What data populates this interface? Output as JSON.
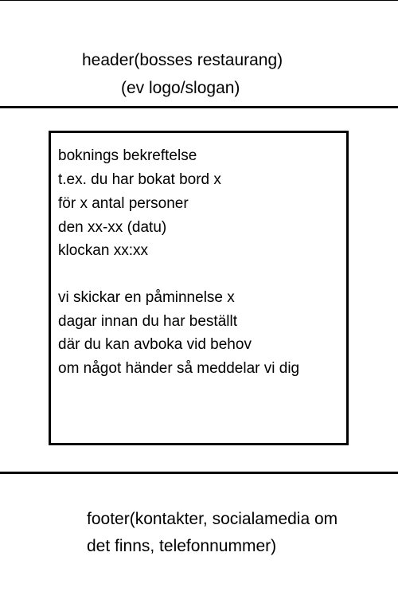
{
  "header": {
    "title": "header(bosses restaurang)",
    "slogan": "(ev logo/slogan)"
  },
  "booking": {
    "lines": [
      "boknings bekreftelse",
      "t.ex. du har bokat bord x",
      "för x antal personer",
      "den xx-xx (datu)",
      "klockan xx:xx",
      "vi skickar en påminnelse x",
      "dagar innan du har beställt",
      "där du kan avboka vid behov",
      "om något händer så meddelar vi dig"
    ]
  },
  "footer": {
    "lines": [
      "footer(kontakter, socialamedia om",
      "det finns, telefonnummer)"
    ]
  }
}
